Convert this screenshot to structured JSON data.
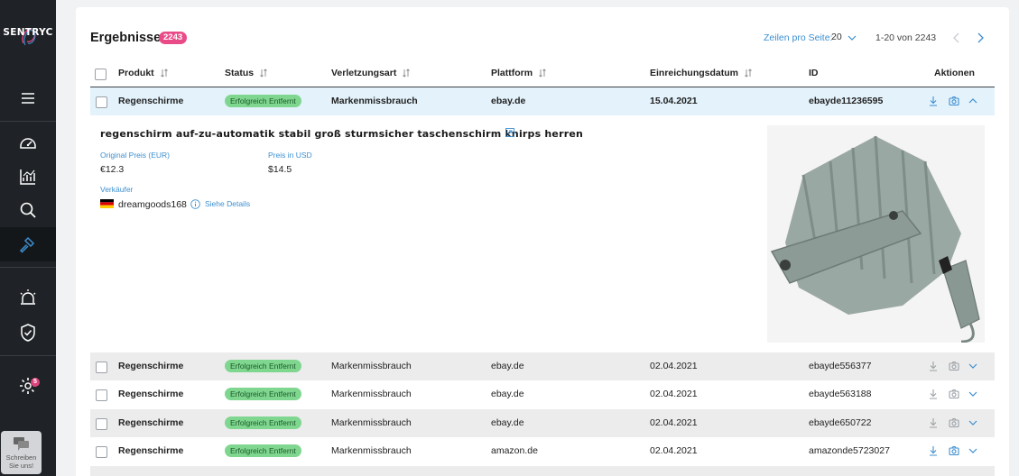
{
  "brand": {
    "logo_text": "SENTRYC"
  },
  "sidebar": {
    "items": [
      {
        "name": "menu",
        "icon": "hamburger-menu-icon"
      },
      {
        "name": "dashboard",
        "icon": "gauge-icon"
      },
      {
        "name": "analytics",
        "icon": "chart-icon"
      },
      {
        "name": "search",
        "icon": "search-icon"
      },
      {
        "name": "enforcement",
        "icon": "gavel-icon"
      },
      {
        "name": "alerts",
        "icon": "siren-icon"
      },
      {
        "name": "protection",
        "icon": "shield-check-icon"
      },
      {
        "name": "settings",
        "icon": "gear-icon"
      }
    ],
    "settings_badge": "5",
    "chat_label": "Schreiben Sie uns!"
  },
  "results": {
    "title": "Ergebnisse",
    "count": "2243",
    "per_page_label": "Zeilen pro Seite:",
    "per_page_value": "20",
    "range_text": "1-20 von 2243"
  },
  "table": {
    "columns": [
      "Produkt",
      "Status",
      "Verletzungsart",
      "Plattform",
      "Einreichungsdatum",
      "ID",
      "Aktionen"
    ],
    "rows": [
      {
        "product": "Regenschirme",
        "status": "Erfolgreich Entfernt",
        "violation": "Markenmissbrauch",
        "platform": "ebay.de",
        "date": "15.04.2021",
        "id": "ebayde11236595"
      },
      {
        "product": "Regenschirme",
        "status": "Erfolgreich Entfernt",
        "violation": "Markenmissbrauch",
        "platform": "ebay.de",
        "date": "02.04.2021",
        "id": "ebayde556377"
      },
      {
        "product": "Regenschirme",
        "status": "Erfolgreich Entfernt",
        "violation": "Markenmissbrauch",
        "platform": "ebay.de",
        "date": "02.04.2021",
        "id": "ebayde563188"
      },
      {
        "product": "Regenschirme",
        "status": "Erfolgreich Entfernt",
        "violation": "Markenmissbrauch",
        "platform": "ebay.de",
        "date": "02.04.2021",
        "id": "ebayde650722"
      },
      {
        "product": "Regenschirme",
        "status": "Erfolgreich Entfernt",
        "violation": "Markenmissbrauch",
        "platform": "amazon.de",
        "date": "02.04.2021",
        "id": "amazonde5723027"
      }
    ]
  },
  "detail": {
    "listing_title": "regenschirm auf-zu-automatik stabil groß sturmsicher taschenschirm knirps herren",
    "original_price_label": "Original Preis (EUR)",
    "original_price": "€12.3",
    "usd_price_label": "Preis in USD",
    "usd_price": "$14.5",
    "seller_label": "Verkäufer",
    "seller_name": "dreamgoods168",
    "details_link": "Siehe Details"
  },
  "colors": {
    "accent": "#3d8fd0",
    "pink": "#e94b88",
    "status_green": "#7fd68f",
    "selected_row": "#e3f2fb",
    "sidebar": "#1f2226"
  }
}
